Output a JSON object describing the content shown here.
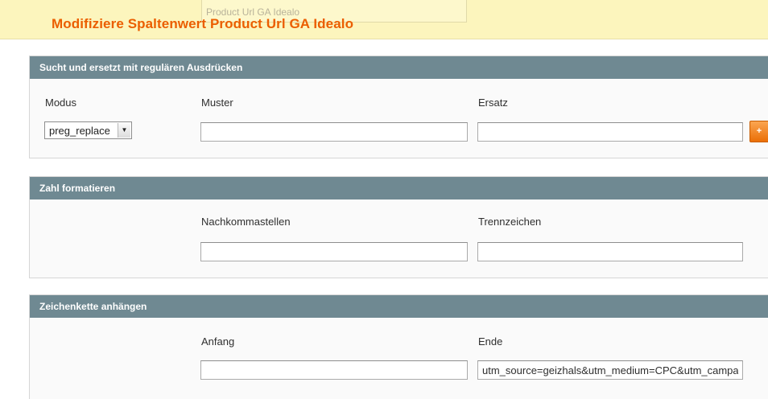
{
  "header": {
    "title": "Modifiziere Spaltenwert Product Url GA Idealo",
    "ghost_text": "Product Url GA Idealo"
  },
  "regex_section": {
    "title": "Sucht und ersetzt mit regulären Ausdrücken",
    "mode_label": "Modus",
    "mode_value": "preg_replace",
    "pattern_label": "Muster",
    "pattern_value": "",
    "replacement_label": "Ersatz",
    "replacement_value": "",
    "add_icon": "plus-icon",
    "add_glyph": "+"
  },
  "number_section": {
    "title": "Zahl formatieren",
    "decimals_label": "Nachkommastellen",
    "decimals_value": "",
    "separator_label": "Trennzeichen",
    "separator_value": ""
  },
  "append_section": {
    "title": "Zeichenkette anhängen",
    "start_label": "Anfang",
    "start_value": "",
    "end_label": "Ende",
    "end_value": "utm_source=geizhals&utm_medium=CPC&utm_campaign=geizhals"
  },
  "colors": {
    "accent": "#eb5e00",
    "header_bg": "#fcf5bd",
    "section_head_bg": "#6f8992",
    "button_orange": "#f08a1f"
  }
}
